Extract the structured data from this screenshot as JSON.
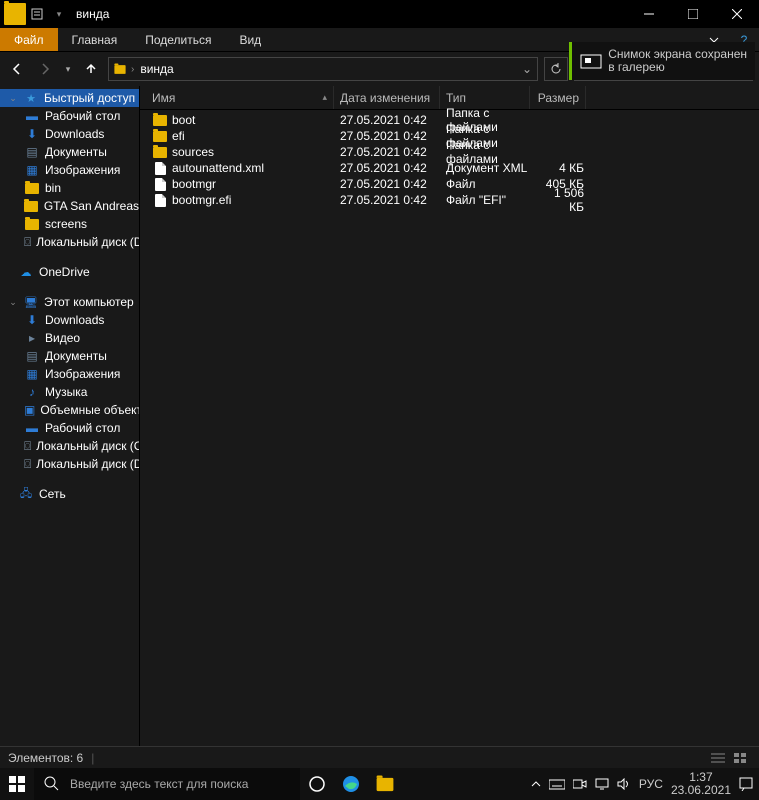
{
  "title": "винда",
  "ribbon": {
    "file": "Файл",
    "home": "Главная",
    "share": "Поделиться",
    "view": "Вид"
  },
  "breadcrumb": {
    "root": "",
    "current": "винда"
  },
  "notification": {
    "line1": "Снимок экрана сохранен",
    "line2": "в галерею"
  },
  "sidebar": {
    "quick_access": "Быстрый доступ",
    "quick": [
      {
        "label": "Рабочий стол",
        "icon": "desktop",
        "color": "#2e7cd6"
      },
      {
        "label": "Downloads",
        "icon": "downloads",
        "color": "#2e7cd6"
      },
      {
        "label": "Документы",
        "icon": "documents",
        "color": "#6b8299"
      },
      {
        "label": "Изображения",
        "icon": "pictures",
        "color": "#2e7cd6"
      },
      {
        "label": "bin",
        "icon": "folder",
        "color": "#e8b400"
      },
      {
        "label": "GTA San Andreas",
        "icon": "folder",
        "color": "#e8b400"
      },
      {
        "label": "screens",
        "icon": "folder",
        "color": "#e8b400"
      },
      {
        "label": "Локальный диск (D:)",
        "icon": "drive",
        "color": "#8aa0b4"
      }
    ],
    "onedrive": "OneDrive",
    "thispc": "Этот компьютер",
    "pc": [
      {
        "label": "Downloads",
        "icon": "downloads",
        "color": "#2e7cd6"
      },
      {
        "label": "Видео",
        "icon": "video",
        "color": "#6b8299"
      },
      {
        "label": "Документы",
        "icon": "documents",
        "color": "#6b8299"
      },
      {
        "label": "Изображения",
        "icon": "pictures",
        "color": "#2e7cd6"
      },
      {
        "label": "Музыка",
        "icon": "music",
        "color": "#2e7cd6"
      },
      {
        "label": "Объемные объекты",
        "icon": "3d",
        "color": "#2e7cd6"
      },
      {
        "label": "Рабочий стол",
        "icon": "desktop",
        "color": "#2e7cd6"
      },
      {
        "label": "Локальный диск (C:)",
        "icon": "drive",
        "color": "#8aa0b4"
      },
      {
        "label": "Локальный диск (D:)",
        "icon": "drive",
        "color": "#8aa0b4"
      }
    ],
    "network": "Сеть"
  },
  "columns": {
    "name": "Имя",
    "date": "Дата изменения",
    "type": "Тип",
    "size": "Размер",
    "sort": "▴"
  },
  "files": [
    {
      "icon": "folder",
      "name": "boot",
      "date": "27.05.2021 0:42",
      "type": "Папка с файлами",
      "size": ""
    },
    {
      "icon": "folder",
      "name": "efi",
      "date": "27.05.2021 0:42",
      "type": "Папка с файлами",
      "size": ""
    },
    {
      "icon": "folder",
      "name": "sources",
      "date": "27.05.2021 0:42",
      "type": "Папка с файлами",
      "size": ""
    },
    {
      "icon": "file",
      "name": "autounattend.xml",
      "date": "27.05.2021 0:42",
      "type": "Документ XML",
      "size": "4 КБ"
    },
    {
      "icon": "file",
      "name": "bootmgr",
      "date": "27.05.2021 0:42",
      "type": "Файл",
      "size": "405 КБ"
    },
    {
      "icon": "file",
      "name": "bootmgr.efi",
      "date": "27.05.2021 0:42",
      "type": "Файл \"EFI\"",
      "size": "1 506 КБ"
    }
  ],
  "status": {
    "count": "Элементов: 6"
  },
  "taskbar": {
    "search_placeholder": "Введите здесь текст для поиска",
    "lang": "РУС",
    "time": "1:37",
    "date": "23.06.2021"
  }
}
